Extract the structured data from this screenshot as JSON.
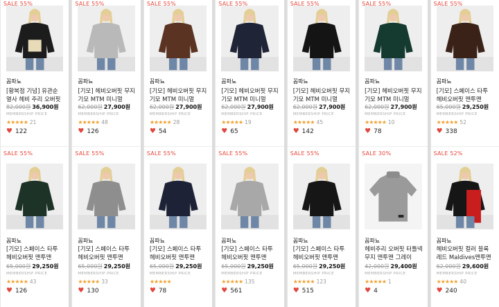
{
  "rows": [
    {
      "cards": [
        {
          "sale": "SALE 55%",
          "brand": "꼼파뇨",
          "name": "[황복점 기념] 유관순 열사 헤비 주리 오버핏",
          "old_price": "82,000원",
          "price": "36,900원",
          "membership": "MEMBERSHIP PRICE",
          "stars": "★★★★★",
          "reviews": "21",
          "likes": "122",
          "size": "M",
          "option": "OPTION ▼",
          "shirt": "#1c1c1c",
          "accent": "#e8dcb8"
        },
        {
          "sale": "SALE 55%",
          "brand": "꼼파뇨",
          "name": "[기모] 헤비오버핏 무지 기모 MTM 미니멀",
          "old_price": "62,000원",
          "price": "27,900원",
          "membership": "MEMBERSHIP PRICE",
          "stars": "★★★★★",
          "reviews": "48",
          "likes": "126",
          "size": "M",
          "option": "OPTION ▼",
          "shirt": "#b9b9b9",
          "accent": ""
        },
        {
          "sale": "SALE 55%",
          "brand": "꼼파뇨",
          "name": "[기모] 헤비오버핏 무지 기모 MTM 미니멀",
          "old_price": "62,000원",
          "price": "27,900원",
          "membership": "MEMBERSHIP PRICE",
          "stars": "★★★★★",
          "reviews": "28",
          "likes": "54",
          "size": "M",
          "option": "OPTION ▼",
          "shirt": "#5a3322",
          "accent": ""
        },
        {
          "sale": "SALE 55%",
          "brand": "꼼파뇨",
          "name": "[기모] 헤비오버핏 무지 기모 MTM 미니멀",
          "old_price": "62,000원",
          "price": "27,900원",
          "membership": "MEMBERSHIP PRICE",
          "stars": "★★★★★",
          "reviews": "19",
          "likes": "65",
          "size": "M",
          "option": "OPTION ▼",
          "shirt": "#1f2436",
          "accent": ""
        },
        {
          "sale": "SALE 55%",
          "brand": "꼼파뇨",
          "name": "[기모] 헤비오버핏 무지 기모 MTM 미니멀",
          "old_price": "62,000원",
          "price": "27,900원",
          "membership": "MEMBERSHIP PRICE",
          "stars": "★★★★★",
          "reviews": "45",
          "likes": "142",
          "size": "M",
          "option": "OPTION ▼",
          "shirt": "#141414",
          "accent": ""
        },
        {
          "sale": "SALE 55%",
          "brand": "꼼파뇨",
          "name": "[기모] 헤비오버핏 무지 기모 MTM 미니멀",
          "old_price": "62,000원",
          "price": "27,900원",
          "membership": "MEMBERSHIP PRICE",
          "stars": "★★★★★",
          "reviews": "10",
          "likes": "78",
          "size": "M",
          "option": "OPTION ▼",
          "shirt": "#153a30",
          "accent": ""
        },
        {
          "sale": "SALE 55%",
          "brand": "꼼파뇨",
          "name": "[기모] 스페이스 타투 헤비오버핏 맨투맨",
          "old_price": "65,000원",
          "price": "29,250원",
          "membership": "MEMBERSHIP PRICE",
          "stars": "★★★★★",
          "reviews": "52",
          "likes": "338",
          "size": "W",
          "option": "OPTION ▼",
          "shirt": "#3a2218",
          "accent": ""
        }
      ]
    },
    {
      "cards": [
        {
          "sale": "SALE 55%",
          "brand": "꼼파뇨",
          "name": "[기모] 스페이스 타투 헤비오버핏 맨투맨",
          "old_price": "65,000원",
          "price": "29,250원",
          "membership": "MEMBERSHIP PRICE",
          "stars": "★★★★★",
          "reviews": "43",
          "likes": "126",
          "shirt": "#1e3328"
        },
        {
          "sale": "SALE 55%",
          "brand": "꼼파뇨",
          "name": "[기모] 스페이스 타투 헤비오버핏 맨투맨",
          "old_price": "65,000원",
          "price": "29,250원",
          "membership": "MEMBERSHIP PRICE",
          "stars": "★★★★★",
          "reviews": "33",
          "likes": "130",
          "shirt": "#8e8e8e"
        },
        {
          "sale": "SALE 55%",
          "brand": "꼼파뇨",
          "name": "[기모] 스페이스 타투 헤비오버핏 맨투맨",
          "old_price": "65,000원",
          "price": "29,250원",
          "membership": "MEMBERSHIP PRICE",
          "stars": "★★★★★",
          "reviews": "",
          "likes": "78",
          "shirt": "#1e2236"
        },
        {
          "sale": "SALE 55%",
          "brand": "꼼파뇨",
          "name": "[기모] 스페이스 타투 헤비오버핏 맨투맨",
          "old_price": "65,000원",
          "price": "29,250원",
          "membership": "MEMBERSHIP PRICE",
          "stars": "★★★★★",
          "reviews": "135",
          "likes": "561",
          "shirt": "#a8a8a8"
        },
        {
          "sale": "SALE 55%",
          "brand": "꼼파뇨",
          "name": "[기모] 스페이스 타투 헤비오버핏 맨투맨",
          "old_price": "65,000원",
          "price": "29,250원",
          "membership": "MEMBERSHIP PRICE",
          "stars": "★★★★★",
          "reviews": "123",
          "likes": "515",
          "shirt": "#161616"
        },
        {
          "sale": "SALE 30%",
          "brand": "꼼파뇨",
          "name": "헤비주리 오버핏 터틀넥 무지 맨투맨 그레이",
          "old_price": "42,000원",
          "price": "29,400원",
          "membership": "MEMBERSHIP PRICE",
          "stars": "★★★★★",
          "reviews": "1",
          "likes": "4",
          "shirt": "#9a9a9a"
        },
        {
          "sale": "SALE 52%",
          "brand": "꼼파뇨",
          "name": "헤비오버핏 컬러 블록 레드 Maldives맨투맨",
          "old_price": "62,000원",
          "price": "29,600원",
          "membership": "MEMBERSHIP PRICE",
          "stars": "★★★★★",
          "reviews": "40",
          "likes": "240",
          "shirt": "#161616"
        }
      ]
    }
  ]
}
